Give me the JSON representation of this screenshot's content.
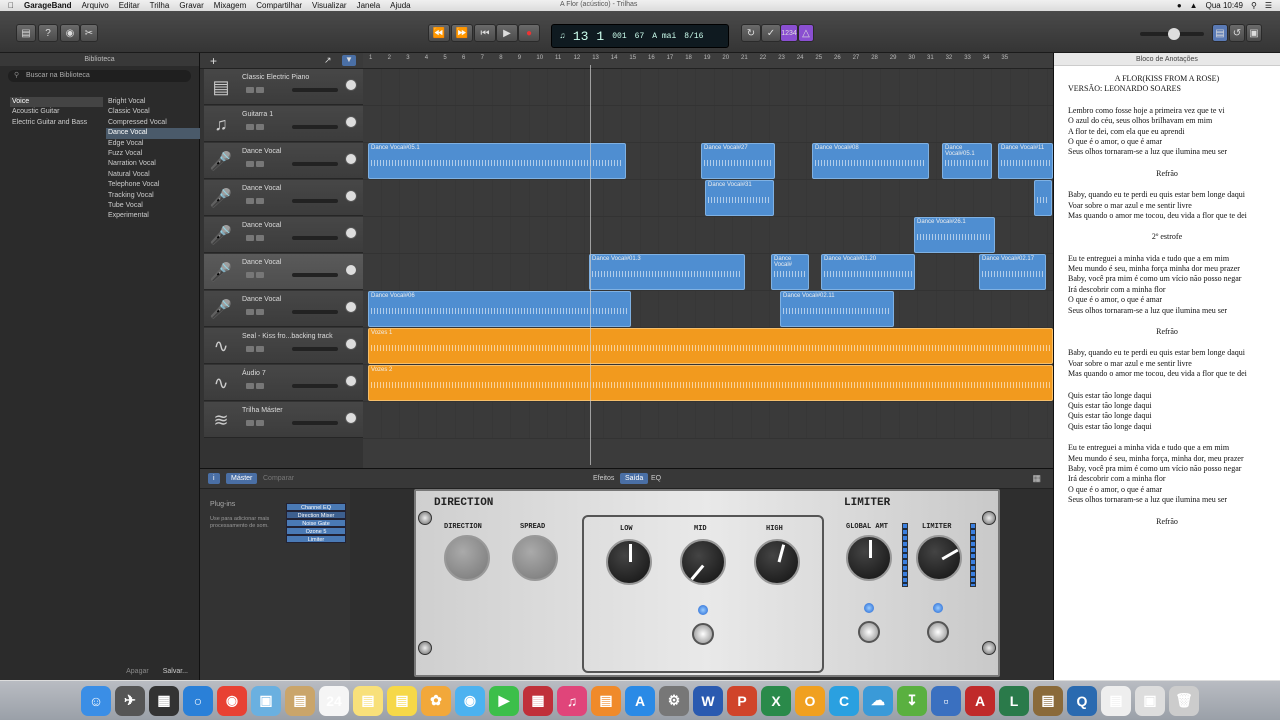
{
  "menubar": {
    "apple": "",
    "app": "GarageBand",
    "items": [
      "Arquivo",
      "Editar",
      "Trilha",
      "Gravar",
      "Mixagem",
      "Compartilhar",
      "Visualizar",
      "Janela",
      "Ajuda"
    ],
    "window_title": "A Flor (acústico) - Trilhas",
    "clock": "Qua 10:49"
  },
  "lcd": {
    "bar": "13",
    "beat": "1",
    "division": "001",
    "tempo": "67",
    "key": "A mai",
    "time_sig": "8/16",
    "count_in": "1234"
  },
  "library": {
    "title": "Biblioteca",
    "search_placeholder": "Buscar na Biblioteca",
    "categories": [
      "Voice",
      "Acoustic Guitar",
      "Electric Guitar and Bass"
    ],
    "presets": [
      "Bright Vocal",
      "Classic Vocal",
      "Compressed Vocal",
      "Dance Vocal",
      "Edge Vocal",
      "Fuzz Vocal",
      "Narration Vocal",
      "Natural Vocal",
      "Telephone Vocal",
      "Tracking Vocal",
      "Tube Vocal",
      "Experimental"
    ],
    "selected_category": "Voice",
    "selected_preset": "Dance Vocal",
    "footer_delete": "Apagar",
    "footer_save": "Salvar..."
  },
  "tracks": [
    {
      "name": "Classic Electric Piano",
      "icon": "piano-icon"
    },
    {
      "name": "Guitarra 1",
      "icon": "guitar-icon"
    },
    {
      "name": "Dance Vocal",
      "icon": "microphone-icon"
    },
    {
      "name": "Dance Vocal",
      "icon": "microphone-icon"
    },
    {
      "name": "Dance Vocal",
      "icon": "microphone-icon"
    },
    {
      "name": "Dance Vocal",
      "icon": "microphone-icon"
    },
    {
      "name": "Dance Vocal",
      "icon": "microphone-icon"
    },
    {
      "name": "Seal - Kiss fro...backing track",
      "icon": "audio-waveform-icon"
    },
    {
      "name": "Áudio 7",
      "icon": "audio-waveform-icon"
    },
    {
      "name": "Trilha Máster",
      "icon": "master-track-icon"
    }
  ],
  "ruler": [
    "1",
    "2",
    "3",
    "4",
    "5",
    "6",
    "7",
    "8",
    "9",
    "10",
    "11",
    "12",
    "13",
    "14",
    "15",
    "16",
    "17",
    "18",
    "19",
    "20",
    "21",
    "22",
    "23",
    "24",
    "25",
    "26",
    "27",
    "28",
    "29",
    "30",
    "31",
    "32",
    "33",
    "34",
    "35"
  ],
  "regions": [
    {
      "lane": 2,
      "label": "Dance Vocal#05.1",
      "color": "blue"
    },
    {
      "lane": 2,
      "label": "Dance Vocal#27",
      "color": "blue"
    },
    {
      "lane": 2,
      "label": "Dance Vocal#08",
      "color": "blue"
    },
    {
      "lane": 2,
      "label": "Dance Vocal#05.1",
      "color": "blue"
    },
    {
      "lane": 2,
      "label": "Dance Vocal#11",
      "color": "blue"
    },
    {
      "lane": 3,
      "label": "Dance Vocal#31",
      "color": "blue"
    },
    {
      "lane": 3,
      "label": "",
      "color": "blue"
    },
    {
      "lane": 4,
      "label": "Dance Vocal#26.1",
      "color": "blue"
    },
    {
      "lane": 5,
      "label": "Dance Vocal#01.3",
      "color": "blue"
    },
    {
      "lane": 5,
      "label": "Dance Vocal#",
      "color": "blue"
    },
    {
      "lane": 5,
      "label": "Dance Vocal#01.20",
      "color": "blue"
    },
    {
      "lane": 5,
      "label": "Dance Vocal#02.17",
      "color": "blue"
    },
    {
      "lane": 6,
      "label": "Dance Vocal#06",
      "color": "blue"
    },
    {
      "lane": 6,
      "label": "Dance Vocal#02.11",
      "color": "blue"
    },
    {
      "lane": 7,
      "label": "Vozes 1",
      "color": "orange"
    },
    {
      "lane": 8,
      "label": "Vozes 2",
      "color": "orange"
    }
  ],
  "lower": {
    "info": "i",
    "tab_master": "Máster",
    "tab_compare": "Comparar",
    "tab_effects": "Efeitos",
    "tab_output": "Saída",
    "tab_eq": "EQ",
    "plugins_label": "Plug-ins",
    "plugins_desc": "Use para adicionar mais processamento de som.",
    "plugins": [
      "Channel EQ",
      "Direction Mixer",
      "Noise Gate",
      "Ozone 5",
      "Limiter"
    ]
  },
  "amp": {
    "direction_title": "DIRECTION",
    "limiter_title": "LIMITER",
    "knob_labels": [
      "DIRECTION",
      "SPREAD",
      "LOW",
      "MID",
      "HIGH",
      "GLOBAL AMT",
      "LIMITER"
    ]
  },
  "notes": {
    "title": "Bloco de Anotações",
    "song_title": "A FLOR(KISS FROM A ROSE)",
    "version": "VERSÃO: LEONARDO SOARES",
    "blocks": [
      {
        "align": "left",
        "lines": [
          "Lembro como fosse hoje a primeira vez que te vi",
          "O azul do céu, seus olhos brilhavam em mim",
          "A flor te dei, com ela que eu aprendi",
          "O que é o amor, o que é amar",
          "Seus olhos tornaram-se a luz que ilumina meu ser"
        ]
      },
      {
        "align": "center",
        "lines": [
          "Refrão"
        ]
      },
      {
        "align": "left",
        "lines": [
          "Baby, quando eu te perdi eu quis estar bem longe daqui",
          "Voar sobre o mar azul e me sentir livre",
          "Mas quando o amor me tocou, deu vida a flor que te dei"
        ]
      },
      {
        "align": "center",
        "lines": [
          "2º estrofe"
        ]
      },
      {
        "align": "left",
        "lines": [
          "Eu te entreguei a minha vida e tudo que a em mim",
          "Meu mundo é seu, minha força minha dor meu prazer",
          "Baby, você pra mim é como um vício não posso negar",
          "Irá descobrir com a minha flor",
          "O que é o amor, o que é amar",
          "Seus olhos tornaram-se a luz que ilumina meu ser"
        ]
      },
      {
        "align": "center",
        "lines": [
          "Refrão"
        ]
      },
      {
        "align": "left",
        "lines": [
          "Baby, quando eu te perdi eu quis estar bem longe daqui",
          "Voar sobre o mar azul e me sentir livre",
          "Mas quando o amor me tocou, deu vida a flor que te dei"
        ]
      },
      {
        "align": "left",
        "lines": [
          "Quis estar tão longe daqui",
          "Quis estar tão longe daqui",
          "Quis estar tão longe daqui",
          "Quis estar tão longe daqui"
        ]
      },
      {
        "align": "left",
        "lines": [
          "Eu te entreguei a minha vida e tudo que a em mim",
          "Meu mundo é seu, minha força, minha dor, meu prazer",
          "Baby, você pra mim é como um vício não posso negar",
          "Irá descobrir com a minha flor",
          "O que é o amor, o que é amar",
          "Seus olhos tornaram-se a luz que ilumina meu ser"
        ]
      },
      {
        "align": "center",
        "lines": [
          "Refrão"
        ]
      }
    ]
  },
  "colors": {
    "region_blue": "#4f8ed1",
    "region_orange": "#f29a1e",
    "accent": "#4a6fa5"
  }
}
